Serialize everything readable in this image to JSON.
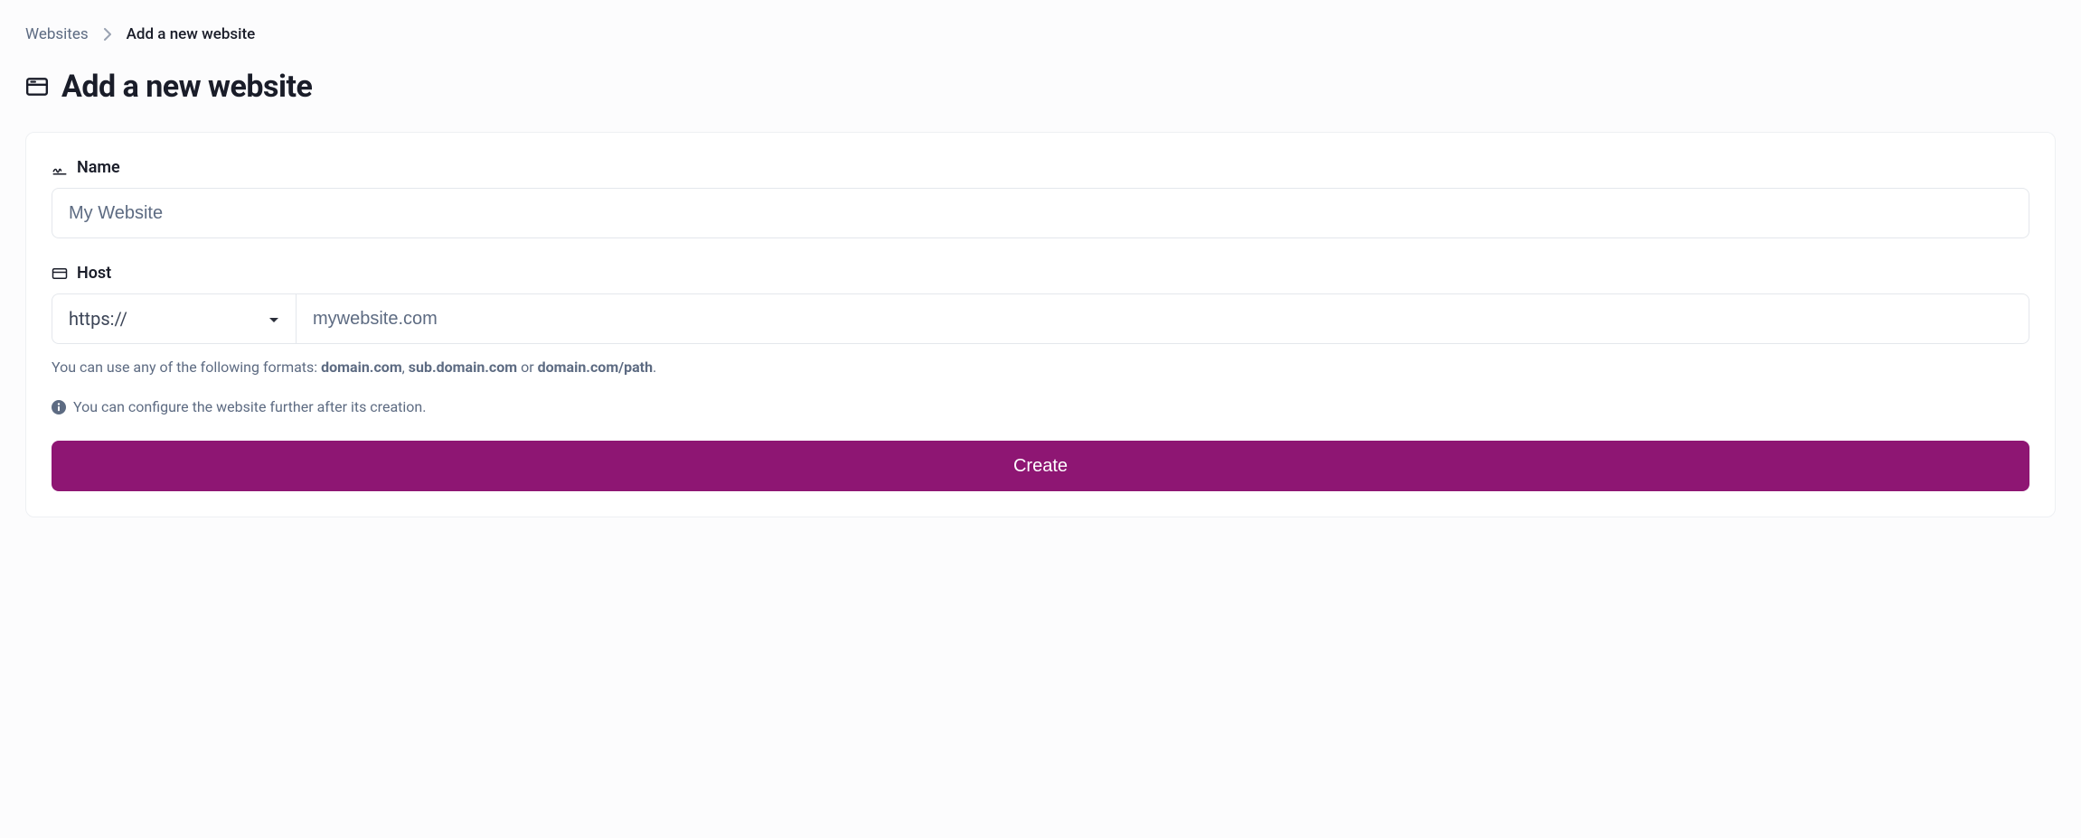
{
  "breadcrumb": {
    "parent": "Websites",
    "current": "Add a new website"
  },
  "page": {
    "title": "Add a new website"
  },
  "form": {
    "name": {
      "label": "Name",
      "placeholder": "My Website",
      "value": ""
    },
    "host": {
      "label": "Host",
      "protocol_selected": "https://",
      "placeholder": "mywebsite.com",
      "value": ""
    },
    "hint": {
      "prefix": "You can use any of the following formats: ",
      "example1": "domain.com",
      "sep1": ", ",
      "example2": "sub.domain.com",
      "sep2": " or ",
      "example3": "domain.com/path",
      "suffix": "."
    },
    "info": "You can configure the website further after its creation.",
    "submit_label": "Create"
  }
}
